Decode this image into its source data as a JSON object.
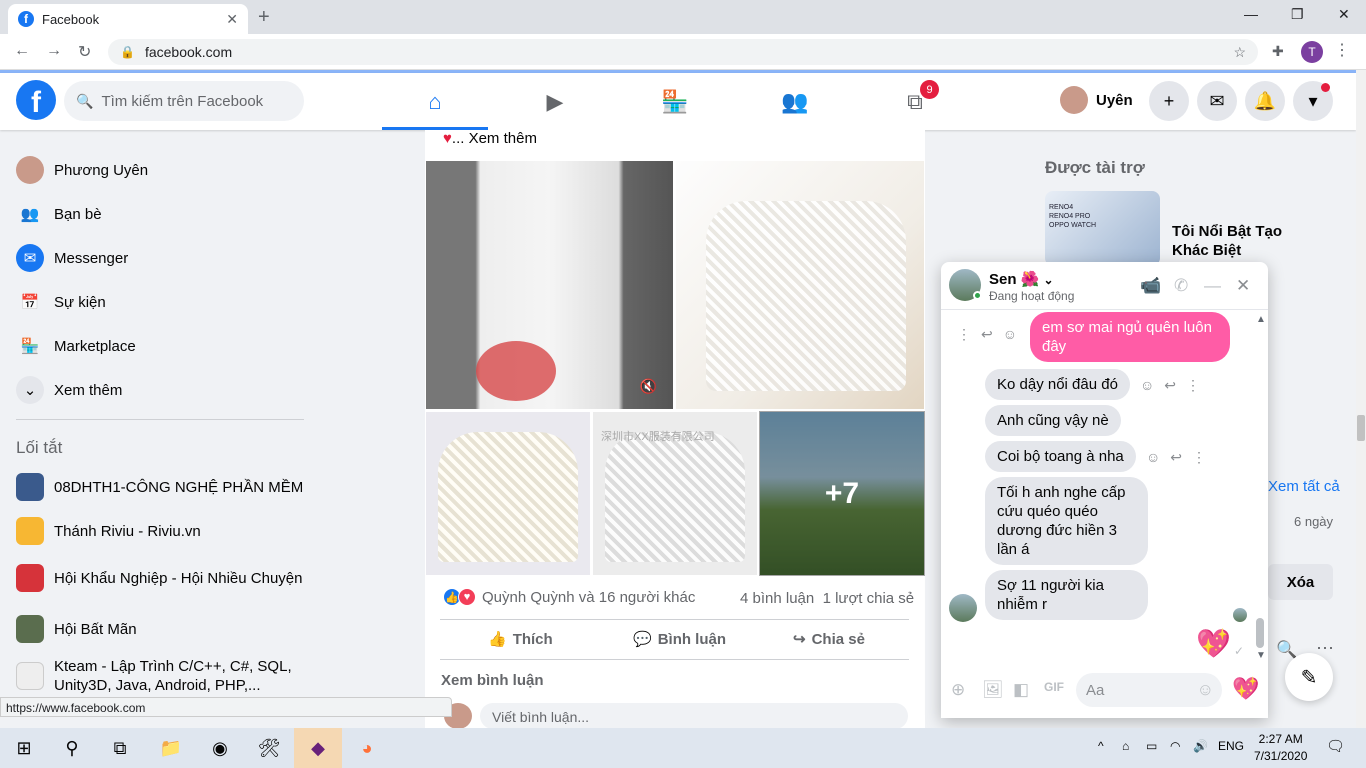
{
  "browser": {
    "tab_title": "Facebook",
    "url": "facebook.com",
    "status_url": "https://www.facebook.com",
    "profile_initial": "T"
  },
  "header": {
    "search_placeholder": "Tìm kiếm trên Facebook",
    "badge_count": "9",
    "me_name": "Uyên",
    "brand_color": "#1877f2"
  },
  "left_nav": {
    "items": [
      {
        "label": "Phương Uyên",
        "icon": "avatar"
      },
      {
        "label": "Bạn bè",
        "icon": "friends-icon"
      },
      {
        "label": "Messenger",
        "icon": "messenger-icon"
      },
      {
        "label": "Sự kiện",
        "icon": "events-icon"
      },
      {
        "label": "Marketplace",
        "icon": "marketplace-icon"
      },
      {
        "label": "Xem thêm",
        "icon": "chevron-down-icon"
      }
    ],
    "shortcuts_title": "Lối tắt",
    "shortcuts": [
      {
        "label": "08DHTH1-CÔNG NGHỆ PHẦN MỀM"
      },
      {
        "label": "Thánh Riviu - Riviu.vn"
      },
      {
        "label": "Hội Khẩu Nghiệp - Hội Nhiều Chuyện"
      },
      {
        "label": "Hội Bất Mãn"
      },
      {
        "label": "Kteam - Lập Trình C/C++, C#, SQL, Unity3D, Java, Android, PHP,..."
      }
    ]
  },
  "post": {
    "see_more": "... Xem thêm",
    "more_photos": "+7",
    "photo_caption": "深圳市XX服装有限公司",
    "reactions_text": "Quỳnh Quỳnh và 16 người khác",
    "comments_shares": "4 bình luận  1 lượt chia sẻ",
    "actions": {
      "like": "Thích",
      "comment": "Bình luận",
      "share": "Chia sẻ"
    },
    "view_comments": "Xem bình luận",
    "comment_placeholder": "Viết bình luận..."
  },
  "right_sidebar": {
    "sponsored_title": "Được tài trợ",
    "ad_title": "Tôi Nổi Bật Tạo Khác Biệt",
    "ad_image_text": "RENO4\nRENO4 PRO\nOPPO WATCH",
    "see_all": "Xem tất cả",
    "time_ago": "6 ngày",
    "delete_label": "Xóa"
  },
  "chat": {
    "name": "Sen",
    "status": "Đang hoạt động",
    "messages": [
      {
        "from": "me",
        "text": "em sơ mai ngủ quên luôn đây"
      },
      {
        "from": "them",
        "text": "Ko dậy nổi đâu đó"
      },
      {
        "from": "them",
        "text": "Anh cũng vậy nè"
      },
      {
        "from": "them",
        "text": "Coi bộ toang à nha"
      },
      {
        "from": "them",
        "text": "Tối h anh nghe cấp cứu quéo quéo dương đức hiền 3 lần á"
      },
      {
        "from": "them",
        "text": "Sợ 11 người kia nhiễm r"
      }
    ],
    "input_placeholder": "Aa",
    "accent_color": "#ff5ca6"
  },
  "taskbar": {
    "time": "2:27 AM",
    "date": "7/31/2020",
    "lang": "ENG"
  }
}
